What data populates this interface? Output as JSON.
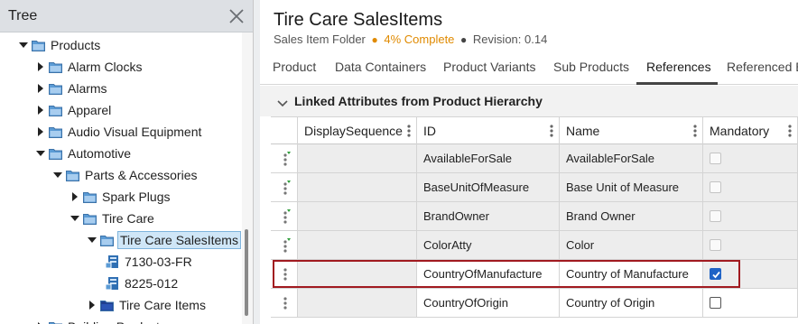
{
  "tree": {
    "title": "Tree",
    "items": [
      {
        "label": "Products",
        "level": 0,
        "toggle": "open",
        "icon": "folder-icon"
      },
      {
        "label": "Alarm Clocks",
        "level": 1,
        "toggle": "closed",
        "icon": "folder-icon"
      },
      {
        "label": "Alarms",
        "level": 1,
        "toggle": "closed",
        "icon": "folder-icon"
      },
      {
        "label": "Apparel",
        "level": 1,
        "toggle": "closed",
        "icon": "folder-icon"
      },
      {
        "label": "Audio Visual Equipment",
        "level": 1,
        "toggle": "closed",
        "icon": "folder-icon"
      },
      {
        "label": "Automotive",
        "level": 1,
        "toggle": "open",
        "icon": "folder-icon"
      },
      {
        "label": "Parts & Accessories",
        "level": 2,
        "toggle": "open",
        "icon": "folder-icon"
      },
      {
        "label": "Spark Plugs",
        "level": 3,
        "toggle": "closed",
        "icon": "folder-icon"
      },
      {
        "label": "Tire Care",
        "level": 3,
        "toggle": "open",
        "icon": "folder-icon"
      },
      {
        "label": "Tire Care SalesItems",
        "level": 4,
        "toggle": "open",
        "icon": "folder-icon",
        "selected": true
      },
      {
        "label": "7130-03-FR",
        "level": 5,
        "toggle": "none",
        "icon": "product-item-icon"
      },
      {
        "label": "8225-012",
        "level": 5,
        "toggle": "none",
        "icon": "product-item-icon"
      },
      {
        "label": "Tire Care Items",
        "level": 4,
        "toggle": "closed",
        "icon": "folder-dark-icon"
      },
      {
        "label": "Building Products",
        "level": 1,
        "toggle": "closed",
        "icon": "folder-icon"
      }
    ]
  },
  "header": {
    "title": "Tire Care SalesItems",
    "type": "Sales Item Folder",
    "complete": "4% Complete",
    "revision": "Revision: 0.14"
  },
  "tabs": [
    {
      "label": "Product",
      "active": false
    },
    {
      "label": "Data Containers",
      "active": false
    },
    {
      "label": "Product Variants",
      "active": false
    },
    {
      "label": "Sub Products",
      "active": false
    },
    {
      "label": "References",
      "active": true
    },
    {
      "label": "Referenced By",
      "active": false
    }
  ],
  "section": {
    "title": "Linked Attributes from Product Hierarchy"
  },
  "grid": {
    "columns": [
      "DisplaySequence",
      "ID",
      "Name",
      "Mandatory"
    ],
    "rows": [
      {
        "display_sequence": "",
        "id": "AvailableForSale",
        "name": "AvailableForSale",
        "mandatory": false,
        "editable": false,
        "highlighted": false
      },
      {
        "display_sequence": "",
        "id": "BaseUnitOfMeasure",
        "name": "Base Unit of Measure",
        "mandatory": false,
        "editable": false,
        "highlighted": false
      },
      {
        "display_sequence": "",
        "id": "BrandOwner",
        "name": "Brand Owner",
        "mandatory": false,
        "editable": false,
        "highlighted": false
      },
      {
        "display_sequence": "",
        "id": "ColorAtty",
        "name": "Color",
        "mandatory": false,
        "editable": false,
        "highlighted": false
      },
      {
        "display_sequence": "",
        "id": "CountryOfManufacture",
        "name": "Country of Manufacture",
        "mandatory": true,
        "editable": true,
        "highlighted": true
      },
      {
        "display_sequence": "",
        "id": "CountryOfOrigin",
        "name": "Country of Origin",
        "mandatory": false,
        "editable": true,
        "highlighted": false
      }
    ]
  },
  "colors": {
    "accent_orange": "#e08a00",
    "checkbox_blue": "#1f63c6",
    "highlight_red": "#a11a20",
    "folder_blue": "#5b9bd5",
    "folder_dark": "#1f3f8f"
  }
}
